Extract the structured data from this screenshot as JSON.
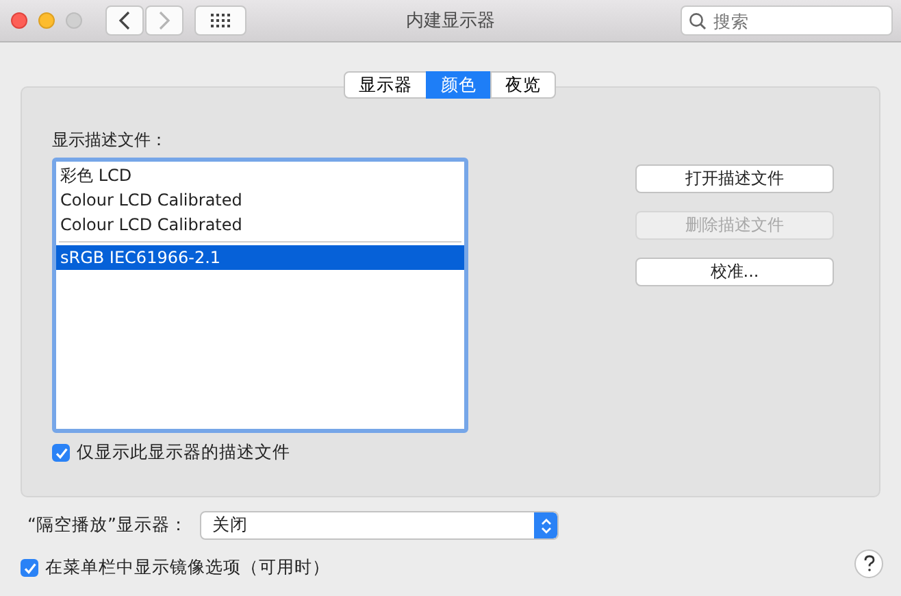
{
  "window": {
    "title": "内建显示器"
  },
  "toolbar": {
    "back": {
      "disabled": false
    },
    "forward": {
      "disabled": true
    },
    "search": {
      "placeholder": "搜索"
    }
  },
  "tabs": [
    {
      "label": "显示器",
      "selected": false
    },
    {
      "label": "颜色",
      "selected": true
    },
    {
      "label": "夜览",
      "selected": false
    }
  ],
  "profiles": {
    "label": "显示描述文件：",
    "items": [
      {
        "kind": "profile",
        "label": "彩色 LCD",
        "selected": false
      },
      {
        "kind": "profile",
        "label": "Colour LCD Calibrated",
        "selected": false
      },
      {
        "kind": "profile",
        "label": "Colour LCD Calibrated",
        "selected": false
      },
      {
        "kind": "separator"
      },
      {
        "kind": "profile",
        "label": "sRGB IEC61966-2.1",
        "selected": true
      }
    ],
    "only_this_display": {
      "label": "仅显示此显示器的描述文件",
      "checked": true
    }
  },
  "buttons": [
    {
      "label": "打开描述文件",
      "disabled": false
    },
    {
      "label": "删除描述文件",
      "disabled": true
    },
    {
      "label": "校准...",
      "disabled": false
    }
  ],
  "airplay": {
    "label": "“隔空播放”显示器：",
    "value": "关闭"
  },
  "mirroring": {
    "label": "在菜单栏中显示镜像选项（可用时）",
    "checked": true
  }
}
